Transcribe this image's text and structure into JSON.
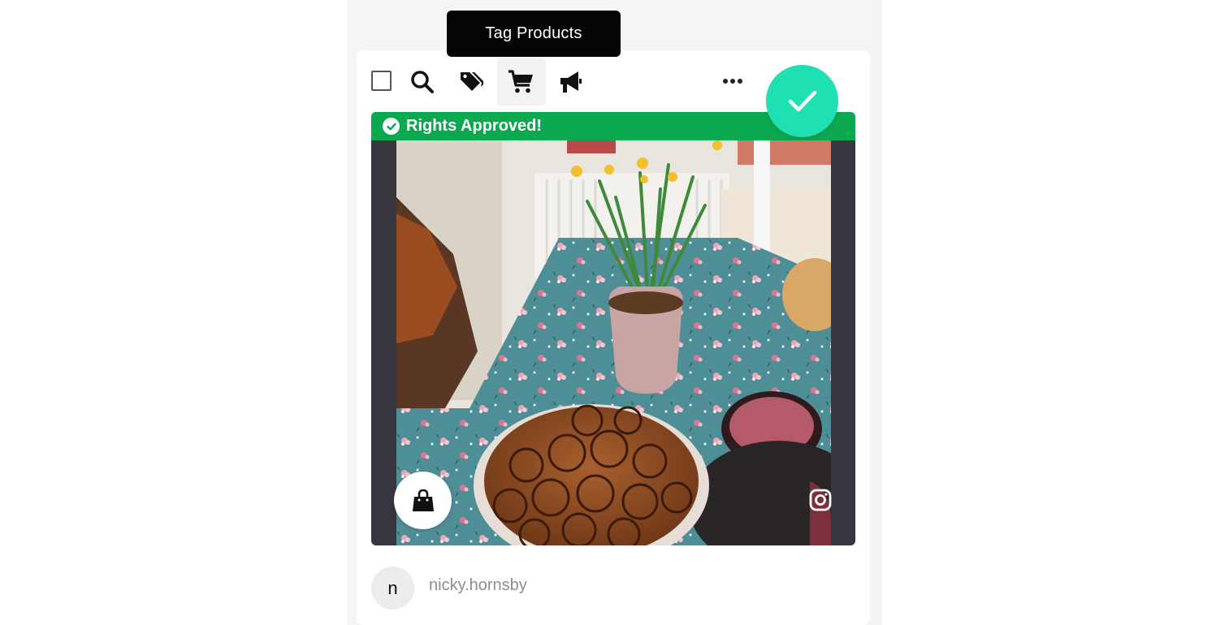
{
  "tooltip": {
    "text": "Tag Products"
  },
  "toolbar": {
    "icons": [
      "select-checkbox",
      "search-icon",
      "tags-icon",
      "cart-icon",
      "megaphone-icon",
      "more-horizontal-icon"
    ],
    "active_tool": "cart-icon"
  },
  "media": {
    "status_label": "Rights Approved!",
    "status_color": "#0aa94f",
    "approve_color": "#1ee0b2",
    "shop_icon": "shopping-bag-icon",
    "source_icon": "instagram-icon"
  },
  "author": {
    "initial": "n",
    "username": "nicky.hornsby"
  }
}
